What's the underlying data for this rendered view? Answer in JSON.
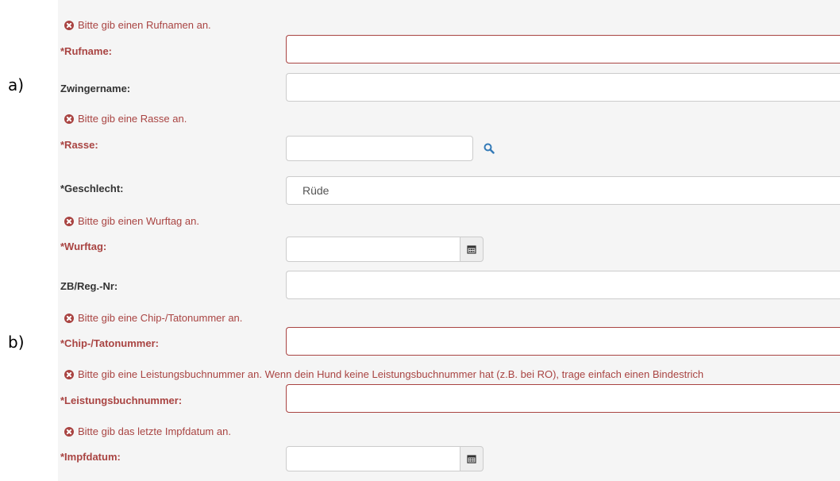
{
  "annotations": {
    "a": "a)",
    "b": "b)"
  },
  "form": {
    "errors": {
      "rufname": "Bitte gib einen Rufnamen an.",
      "rasse": "Bitte gib eine Rasse an.",
      "wurftag": "Bitte gib einen Wurftag an.",
      "chip": "Bitte gib eine Chip-/Tatonummer an.",
      "leistung": "Bitte gib eine Leistungsbuchnummer an. Wenn dein Hund keine Leistungsbuchnummer hat (z.B. bei RO), trage einfach einen Bindestrich",
      "impf": "Bitte gib das letzte Impfdatum an."
    },
    "labels": {
      "rufname": "*Rufname:",
      "zwingername": "Zwingername:",
      "rasse": "*Rasse:",
      "geschlecht": "*Geschlecht:",
      "wurftag": "*Wurftag:",
      "zb": "ZB/Reg.-Nr:",
      "chip": "*Chip-/Tatonummer:",
      "leistung": "*Leistungsbuchnummer:",
      "impf": "*Impfdatum:"
    },
    "values": {
      "rufname": "",
      "zwingername": "",
      "rasse": "",
      "geschlecht": "Rüde",
      "wurftag": "",
      "zb": "",
      "chip": "",
      "leistung": "",
      "impf": ""
    }
  },
  "icons": {
    "error": "error-circle-x-icon",
    "search": "magnifier-icon",
    "calendar": "calendar-icon"
  },
  "colors": {
    "error": "#a94442",
    "search": "#337ab7",
    "panel": "#f5f5f5"
  }
}
